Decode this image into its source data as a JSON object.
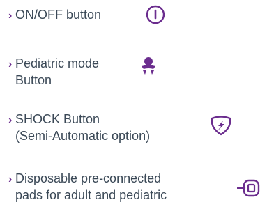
{
  "features": [
    {
      "lines": [
        "ON/OFF button"
      ],
      "icon": "power-icon"
    },
    {
      "lines": [
        "Pediatric mode",
        "Button"
      ],
      "icon": "baby-icon"
    },
    {
      "lines": [
        "SHOCK Button",
        "(Semi-Automatic option)"
      ],
      "icon": "shock-icon"
    },
    {
      "lines": [
        "Disposable pre-connected",
        "pads for adult and pediatric"
      ],
      "icon": "pads-connector-icon"
    }
  ],
  "colors": {
    "accent": "#6b2d8e",
    "text": "#3a4856"
  }
}
